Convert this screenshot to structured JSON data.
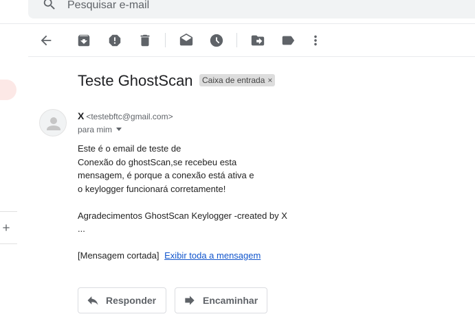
{
  "search": {
    "placeholder": "Pesquisar e-mail",
    "icon": "search-icon"
  },
  "toolbar": {
    "icons": [
      "back-arrow-icon",
      "archive-icon",
      "report-spam-icon",
      "delete-icon",
      "mark-unread-icon",
      "snooze-icon",
      "move-to-icon",
      "label-icon",
      "more-vert-icon"
    ],
    "icon_color": "#5f6368"
  },
  "email": {
    "subject": "Teste GhostScan",
    "label_chip": "Caixa de entrada",
    "label_chip_close": "×",
    "sender_name": "X",
    "sender_email": "<testebftc@gmail.com>",
    "to": "para mim",
    "body_lines": [
      "Este é o email de teste de",
      "Conexão do ghostScan,se recebeu esta",
      "mensagem, é porque a conexão está ativa e",
      "o keylogger funcionará corretamente!",
      "Agradecimentos GhostScan Keylogger -created by X",
      "..."
    ],
    "clipped_label": "[Mensagem cortada]",
    "view_entire_link": "Exibir toda a mensagem"
  },
  "actions": {
    "reply_label": "Responder",
    "forward_label": "Encaminhar"
  },
  "colors": {
    "accent_link": "#1155cc",
    "chip_bg": "#dddddd",
    "compose_hint": "#fce8e6"
  }
}
